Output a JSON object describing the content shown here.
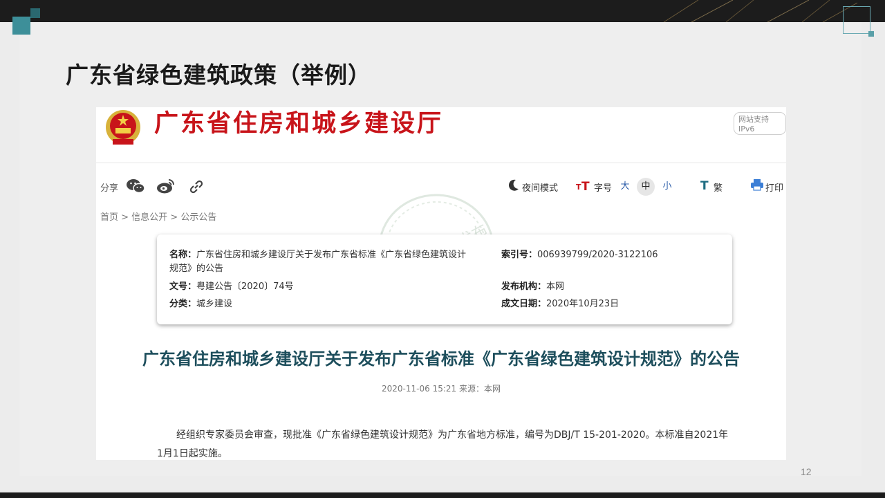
{
  "slide": {
    "title": "广东省绿色建筑政策（举例）",
    "page_number": "12"
  },
  "screenshot": {
    "site_name": "广东省住房和城乡建设厅",
    "ipv6_badge": "网站支持IPv6",
    "share_label": "分享",
    "toolbar": {
      "night_mode": "夜间模式",
      "font_size_label": "字号",
      "size_large": "大",
      "size_medium": "中",
      "size_small": "小",
      "traditional": "繁",
      "print": "打印"
    },
    "breadcrumb": "首页 > 信息公开 > 公示公告",
    "watermark_text": "绿建集成网发布",
    "card": {
      "name_label": "名称：",
      "name_value_line1": "广东省住房和城乡建设厅关于发布广东省标准《广东省绿色建筑设计",
      "name_value_line2": "规范》的公告",
      "doc_no_label": "文号：",
      "doc_no_value": "粤建公告〔2020〕74号",
      "category_label": "分类：",
      "category_value": "城乡建设",
      "index_label": "索引号：",
      "index_value": "006939799/2020-3122106",
      "publisher_label": "发布机构：",
      "publisher_value": "本网",
      "date_label": "成文日期：",
      "date_value": "2020年10月23日"
    },
    "headline": "广东省住房和城乡建设厅关于发布广东省标准《广东省绿色建筑设计规范》的公告",
    "meta": "2020-11-06  15:21    来源：本网",
    "body_line1": "经组织专家委员会审查，现批准《广东省绿色建筑设计规范》为广东省地方标准，编号为DBJ/T 15-201-2020。本标准自2021年",
    "body_line2": "1月1日起实施。"
  },
  "colors": {
    "site_red": "#c8141a",
    "headline_teal": "#1d4e5c",
    "accent_teal": "#3d8f99"
  }
}
